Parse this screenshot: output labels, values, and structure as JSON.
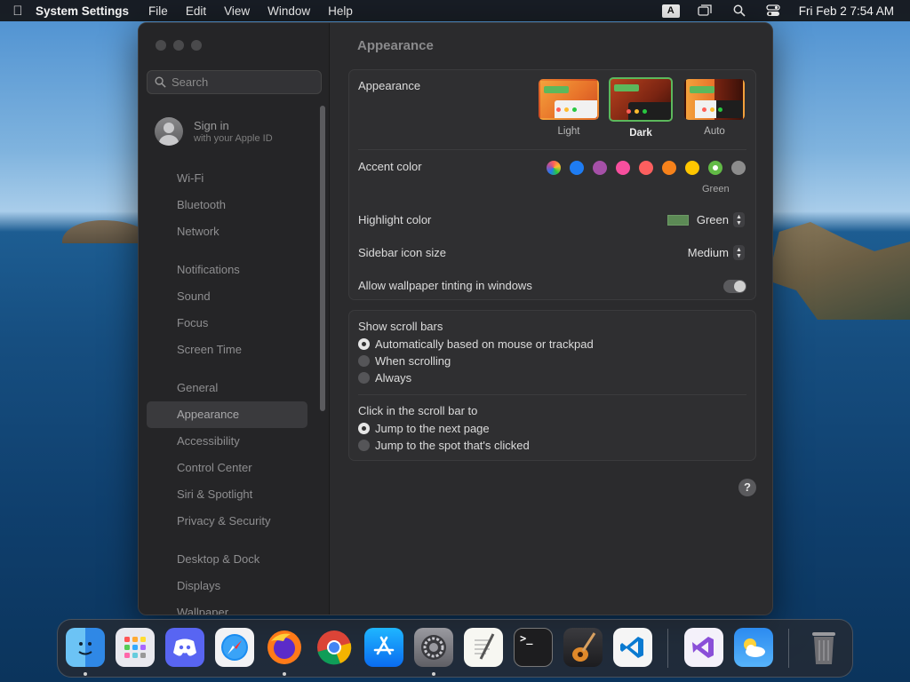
{
  "menubar": {
    "app_name": "System Settings",
    "menus": [
      "File",
      "Edit",
      "View",
      "Window",
      "Help"
    ],
    "input_source": "A",
    "datetime": "Fri Feb 2  7:54 AM"
  },
  "sidebar": {
    "search_placeholder": "Search",
    "account": {
      "title": "Sign in",
      "subtitle": "with your Apple ID"
    },
    "items": [
      "Wi-Fi",
      "Bluetooth",
      "Network",
      "Notifications",
      "Sound",
      "Focus",
      "Screen Time",
      "General",
      "Appearance",
      "Accessibility",
      "Control Center",
      "Siri & Spotlight",
      "Privacy & Security",
      "Desktop & Dock",
      "Displays",
      "Wallpaper"
    ],
    "selected": "Appearance"
  },
  "main": {
    "title": "Appearance",
    "appearance": {
      "label": "Appearance",
      "options": [
        "Light",
        "Dark",
        "Auto"
      ],
      "selected": "Dark"
    },
    "accent": {
      "label": "Accent color",
      "selected_name": "Green",
      "colors": [
        "multicolor",
        "#1e7cf2",
        "#a550a7",
        "#f74f9e",
        "#fc5f5f",
        "#f7821b",
        "#ffc600",
        "#62ba46",
        "#8c8c8c"
      ]
    },
    "highlight": {
      "label": "Highlight color",
      "value": "Green",
      "swatch": "#5c8a55"
    },
    "icon_size": {
      "label": "Sidebar icon size",
      "value": "Medium"
    },
    "tinting": {
      "label": "Allow wallpaper tinting in windows",
      "enabled": false
    },
    "scroll_bars": {
      "label": "Show scroll bars",
      "options": [
        "Automatically based on mouse or trackpad",
        "When scrolling",
        "Always"
      ],
      "selected": 0
    },
    "click_scroll": {
      "label": "Click in the scroll bar to",
      "options": [
        "Jump to the next page",
        "Jump to the spot that's clicked"
      ],
      "selected": 0
    },
    "help": "?"
  },
  "dock": {
    "apps": [
      "Finder",
      "Launchpad",
      "Discord",
      "Safari",
      "Firefox",
      "Chrome",
      "App Store",
      "System Settings",
      "TextEdit",
      "Terminal",
      "GarageBand",
      "VS Code",
      "Visual Studio",
      "Weather",
      "Trash"
    ],
    "terminal_glyph": ">_"
  }
}
